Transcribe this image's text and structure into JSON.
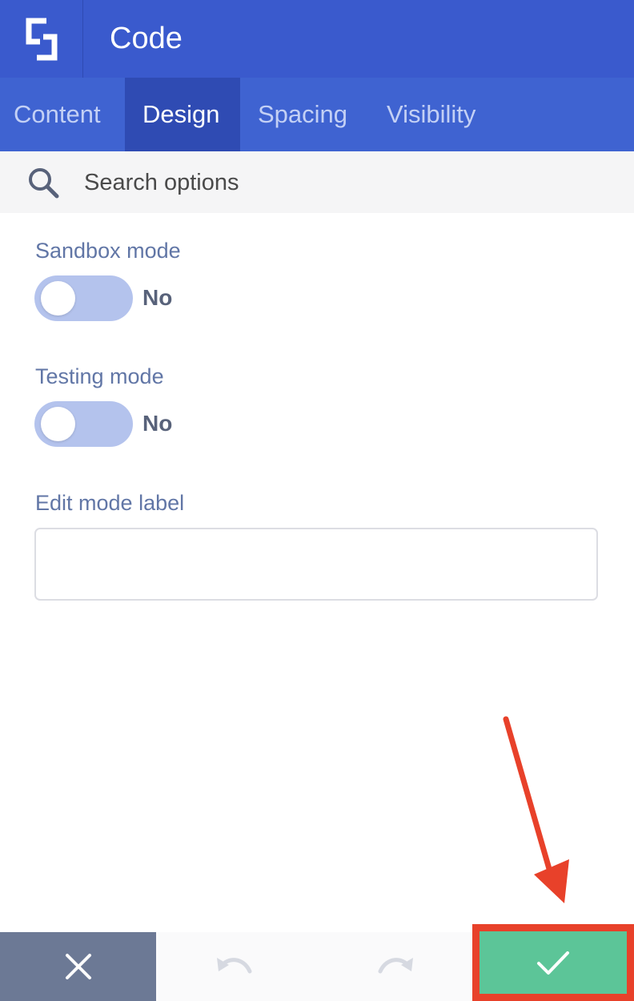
{
  "header": {
    "title": "Code"
  },
  "tabs": [
    {
      "label": "Content",
      "active": false
    },
    {
      "label": "Design",
      "active": true
    },
    {
      "label": "Spacing",
      "active": false
    },
    {
      "label": "Visibility",
      "active": false
    }
  ],
  "search": {
    "placeholder": "Search options"
  },
  "fields": {
    "sandbox": {
      "label": "Sandbox mode",
      "state": "No"
    },
    "testing": {
      "label": "Testing mode",
      "state": "No"
    },
    "edit_label": {
      "label": "Edit mode label",
      "value": ""
    }
  },
  "footer": {
    "icons": [
      "close-icon",
      "undo-icon",
      "redo-icon",
      "check-icon"
    ]
  },
  "colors": {
    "header": "#3a5acd",
    "tabs": "#3f63d1",
    "active_tab": "#2f4bb3",
    "toggle_off": "#b4c3ed",
    "close_button": "#6c7995",
    "save_button": "#5cc598",
    "annotation": "#e8412a"
  }
}
